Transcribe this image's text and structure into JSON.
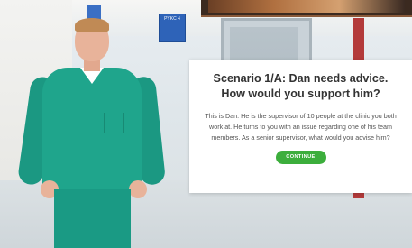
{
  "signs": {
    "room_sign_text": "PYKC 4"
  },
  "scenario": {
    "title": "Scenario 1/A: Dan needs advice. How would you support him?",
    "body": "This is Dan. He is the supervisor of 10 people at the clinic you both work at. He turns to you with an issue regarding one of his team members. As a senior supervisor, what would you advise him?",
    "continue_label": "CONTINUE"
  },
  "colors": {
    "button_green": "#3cae3c",
    "scrub_teal": "#1fa58c",
    "sign_blue": "#2e63b8"
  }
}
